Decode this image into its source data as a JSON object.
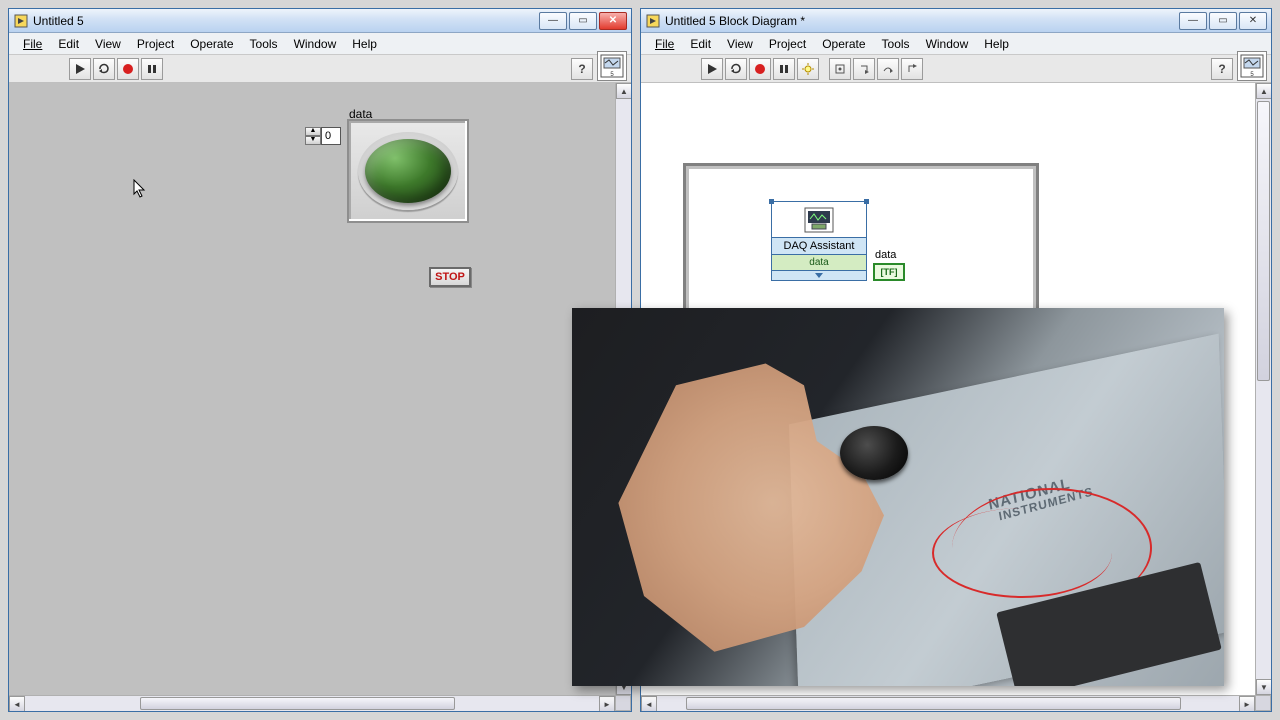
{
  "left_window": {
    "title": "Untitled 5",
    "menu": [
      "File",
      "Edit",
      "View",
      "Project",
      "Operate",
      "Tools",
      "Window",
      "Help"
    ],
    "front_panel": {
      "data_label": "data",
      "index_value": "0",
      "stop_label": "STOP"
    }
  },
  "right_window": {
    "title": "Untitled 5 Block Diagram *",
    "menu": [
      "File",
      "Edit",
      "View",
      "Project",
      "Operate",
      "Tools",
      "Window",
      "Help"
    ],
    "block_diagram": {
      "daq_label": "DAQ Assistant",
      "daq_terminal": "data",
      "indicator_label": "data",
      "indicator_term": "[TF]"
    }
  },
  "overlay": {
    "brand_line1": "NATIONAL",
    "brand_line2": "INSTRUMENTS"
  }
}
